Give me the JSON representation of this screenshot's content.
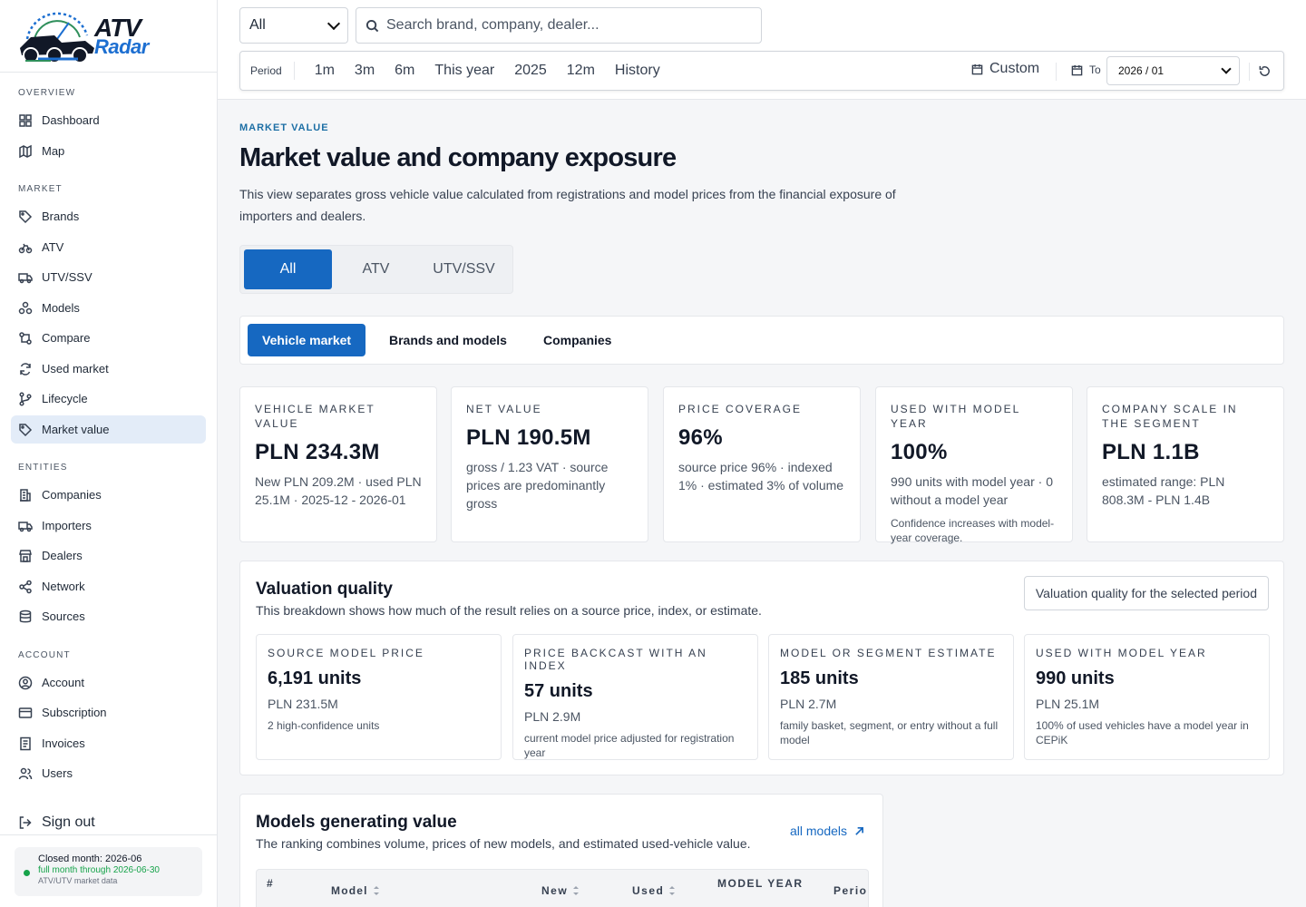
{
  "brand": {
    "name_top": "ATV",
    "name_bottom": "Radar"
  },
  "sidebar": {
    "sections": [
      {
        "title": "OVERVIEW",
        "items": [
          {
            "label": "Dashboard",
            "icon": "grid-icon"
          },
          {
            "label": "Map",
            "icon": "map-icon"
          }
        ]
      },
      {
        "title": "MARKET",
        "items": [
          {
            "label": "Brands",
            "icon": "tag-icon"
          },
          {
            "label": "ATV",
            "icon": "bike-icon"
          },
          {
            "label": "UTV/SSV",
            "icon": "truck-icon"
          },
          {
            "label": "Models",
            "icon": "boxes-icon"
          },
          {
            "label": "Compare",
            "icon": "compare-icon"
          },
          {
            "label": "Used market",
            "icon": "refresh-icon"
          },
          {
            "label": "Lifecycle",
            "icon": "branch-icon"
          },
          {
            "label": "Market value",
            "icon": "tag-icon",
            "active": true
          }
        ]
      },
      {
        "title": "ENTITIES",
        "items": [
          {
            "label": "Companies",
            "icon": "building-icon"
          },
          {
            "label": "Importers",
            "icon": "truck-icon"
          },
          {
            "label": "Dealers",
            "icon": "store-icon"
          },
          {
            "label": "Network",
            "icon": "network-icon"
          },
          {
            "label": "Sources",
            "icon": "database-icon"
          }
        ]
      },
      {
        "title": "ACCOUNT",
        "items": [
          {
            "label": "Account",
            "icon": "user-circle-icon"
          },
          {
            "label": "Subscription",
            "icon": "card-icon"
          },
          {
            "label": "Invoices",
            "icon": "file-icon"
          },
          {
            "label": "Users",
            "icon": "users-icon"
          }
        ]
      }
    ],
    "sign_out": "Sign out",
    "closed_month": {
      "title": "Closed month: 2026-06",
      "status": "full month through 2026-06-30",
      "note": "ATV/UTV market data",
      "status_color": "#16a34a"
    }
  },
  "topbar": {
    "category_select": "All",
    "search_placeholder": "Search brand, company, dealer...",
    "period_label": "Period",
    "period_options": [
      "1m",
      "3m",
      "6m",
      "This year",
      "2025",
      "12m",
      "History"
    ],
    "custom_label": "Custom",
    "to_label": "To",
    "to_value": "2026 / 01"
  },
  "page": {
    "eyebrow": "MARKET VALUE",
    "title": "Market value and company exposure",
    "description": "This view separates gross vehicle value calculated from registrations and model prices from the financial exposure of importers and dealers.",
    "segments": [
      "All",
      "ATV",
      "UTV/SSV"
    ],
    "active_segment": "All",
    "tabs": [
      "Vehicle market",
      "Brands and models",
      "Companies"
    ],
    "active_tab": "Vehicle market",
    "accent_color": "#1668c1"
  },
  "kpis": [
    {
      "label": "VEHICLE MARKET VALUE",
      "value": "PLN 234.3M",
      "sub": "New PLN 209.2M · used PLN 25.1M · 2025-12 - 2026-01",
      "note": ""
    },
    {
      "label": "NET VALUE",
      "value": "PLN 190.5M",
      "sub": "gross / 1.23 VAT · source prices are predominantly gross",
      "note": ""
    },
    {
      "label": "PRICE COVERAGE",
      "value": "96%",
      "sub": "source price 96% · indexed 1% · estimated 3% of volume",
      "note": ""
    },
    {
      "label": "USED WITH MODEL YEAR",
      "value": "100%",
      "sub": "990 units with model year · 0 without a model year",
      "note": "Confidence increases with model-year coverage."
    },
    {
      "label": "COMPANY SCALE IN THE SEGMENT",
      "value": "PLN 1.1B",
      "sub": "estimated range: PLN 808.3M - PLN 1.4B",
      "note": ""
    }
  ],
  "valuation_quality": {
    "title": "Valuation quality",
    "description": "This breakdown shows how much of the result relies on a source price, index, or estimate.",
    "badge": "Valuation quality for the selected period",
    "cards": [
      {
        "label": "SOURCE MODEL PRICE",
        "units": "6,191 units",
        "amount": "PLN 231.5M",
        "note": "2 high-confidence units"
      },
      {
        "label": "PRICE BACKCAST WITH AN INDEX",
        "units": "57 units",
        "amount": "PLN 2.9M",
        "note": "current model price adjusted for registration year"
      },
      {
        "label": "MODEL OR SEGMENT ESTIMATE",
        "units": "185 units",
        "amount": "PLN 2.7M",
        "note": "family basket, segment, or entry without a full model"
      },
      {
        "label": "USED WITH MODEL YEAR",
        "units": "990 units",
        "amount": "PLN 25.1M",
        "note": "100% of used vehicles have a model year in CEPiK"
      }
    ]
  },
  "models": {
    "title": "Models generating value",
    "description": "The ranking combines volume, prices of new models, and estimated used-vehicle value.",
    "link": "all models",
    "columns": [
      "#",
      "Model",
      "New",
      "Used",
      "MODEL YEAR",
      "Perio"
    ]
  }
}
